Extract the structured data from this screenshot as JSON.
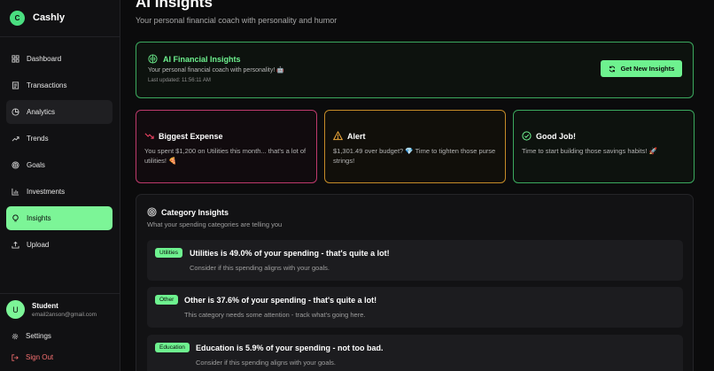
{
  "app": {
    "name": "Cashly",
    "logo_letter": "C",
    "accent": "#6ef28f"
  },
  "sidebar": {
    "items": [
      {
        "label": "Dashboard",
        "icon": "grid-icon"
      },
      {
        "label": "Transactions",
        "icon": "receipt-icon"
      },
      {
        "label": "Analytics",
        "icon": "clock-chart-icon",
        "state": "hover"
      },
      {
        "label": "Trends",
        "icon": "trend-up-icon"
      },
      {
        "label": "Goals",
        "icon": "target-icon"
      },
      {
        "label": "Investments",
        "icon": "bar-chart-icon"
      },
      {
        "label": "Insights",
        "icon": "lightbulb-icon",
        "state": "active"
      },
      {
        "label": "Upload",
        "icon": "upload-icon"
      }
    ],
    "user": {
      "initial": "U",
      "name": "Student",
      "email": "email2anson@gmail.com"
    },
    "settings_label": "Settings",
    "signout_label": "Sign Out"
  },
  "page": {
    "title": "AI Insights",
    "subtitle": "Your personal financial coach with personality and humor"
  },
  "hero": {
    "title": "AI Financial Insights",
    "description": "Your personal financial coach with personality! 🤖",
    "updated": "Last updated: 11:56:11 AM",
    "button_label": "Get New Insights"
  },
  "cards": [
    {
      "title": "Biggest Expense",
      "text": "You spent $1,200 on Utilities this month... that's a lot of utilities! 🍕",
      "color": "#be3a6c",
      "icon": "trend-down-icon"
    },
    {
      "title": "Alert",
      "text": "$1,301.49 over budget? 💎 Time to tighten those purse strings!",
      "color": "#c58b28",
      "icon": "warning-icon"
    },
    {
      "title": "Good Job!",
      "text": "Time to start building those savings habits! 🚀",
      "color": "#3ba95e",
      "icon": "check-circle-icon"
    }
  ],
  "category": {
    "title": "Category Insights",
    "subtitle": "What your spending categories are telling you",
    "rows": [
      {
        "tag": "Utilities",
        "title": "Utilities is 49.0% of your spending - that's quite a lot!",
        "description": "Consider if this spending aligns with your goals."
      },
      {
        "tag": "Other",
        "title": "Other is 37.6% of your spending - that's quite a lot!",
        "description": "This category needs some attention - track what's going here."
      },
      {
        "tag": "Education",
        "title": "Education is 5.9% of your spending - not too bad.",
        "description": "Consider if this spending aligns with your goals."
      }
    ]
  }
}
